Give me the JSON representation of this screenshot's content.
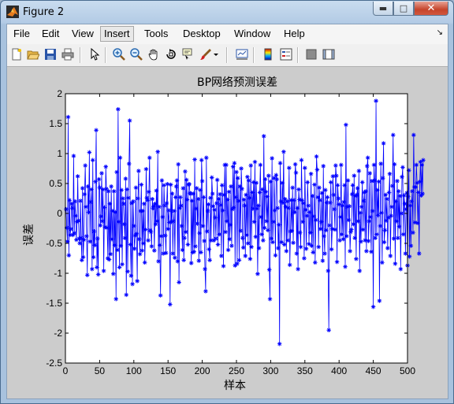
{
  "window": {
    "title": "Figure 2"
  },
  "menu": {
    "items": [
      "File",
      "Edit",
      "View",
      "Insert",
      "Tools",
      "Desktop",
      "Window",
      "Help"
    ]
  },
  "toolbar": {
    "icons": [
      "new-figure-icon",
      "open-file-icon",
      "save-icon",
      "print-icon",
      "select-arrow-icon",
      "zoom-in-icon",
      "zoom-out-icon",
      "pan-hand-icon",
      "rotate-3d-icon",
      "data-cursor-icon",
      "brush-icon",
      "link-plot-icon",
      "colorbar-icon",
      "legend-icon",
      "hide-plot-tools-icon",
      "show-plot-tools-icon"
    ]
  },
  "chart_data": {
    "type": "line",
    "title": "BP网络预测误差",
    "xlabel": "样本",
    "ylabel": "误差",
    "xlim": [
      0,
      500
    ],
    "ylim": [
      -2.5,
      2
    ],
    "xticks": [
      0,
      50,
      100,
      150,
      200,
      250,
      300,
      350,
      400,
      450,
      500
    ],
    "yticks": [
      -2.5,
      -2,
      -1.5,
      -1,
      -0.5,
      0,
      0.5,
      1,
      1.5,
      2
    ],
    "ytick_labels": [
      "-2.5",
      "-2",
      "-1.5",
      "-1",
      "-0.5",
      "0",
      "0.5",
      "1",
      "1.5",
      "2"
    ],
    "grid": false,
    "series": [
      {
        "color": "#0000ff",
        "marker": "*",
        "n_points": 500,
        "values": [
          0.07,
          -0.24,
          -0.47,
          1.61,
          -0.7,
          0.22,
          -0.36,
          -0.26,
          0.16,
          0.09,
          -0.36,
          0.96,
          -0.33,
          0.2,
          -0.04,
          -0.44,
          -0.14,
          0.62,
          -0.12,
          -0.42,
          -0.5,
          0.21,
          -0.41,
          -0.78,
          0.42,
          -0.73,
          -0.44,
          0.32,
          0.8,
          0.11,
          -0.38,
          -1.03,
          0.45,
          0.02,
          1.02,
          -0.47,
          0.19,
          0.4,
          -0.93,
          0.89,
          -0.73,
          -0.3,
          -0.53,
          0.53,
          1.39,
          -0.9,
          -0.42,
          -1.02,
          0.57,
          0.43,
          -0.2,
          -0.05,
          0.67,
          -0.13,
          0.4,
          -0.96,
          0.1,
          -0.23,
          0.78,
          0.41,
          -0.24,
          -0.75,
          0.37,
          -0.77,
          0.16,
          -0.68,
          0.45,
          -0.43,
          0.04,
          -1.01,
          0.37,
          -0.53,
          0.02,
          -1.43,
          0.69,
          -0.61,
          1.74,
          -0.14,
          -0.9,
          0.93,
          -0.54,
          0.39,
          -0.85,
          0.25,
          0.16,
          -0.18,
          -0.41,
          0.58,
          -1.36,
          0.4,
          -0.97,
          0.26,
          0.83,
          1.55,
          -0.52,
          -1.04,
          0.17,
          -1.18,
          0.2,
          -0.21,
          -0.59,
          -0.37,
          0.43,
          -0.34,
          -1.13,
          0.25,
          0.71,
          -0.43,
          -0.68,
          0.04,
          0.48,
          -0.62,
          0.04,
          -0.5,
          0.16,
          -0.82,
          -0.27,
          0.74,
          0.26,
          0.22,
          -0.45,
          0.36,
          0.93,
          -0.28,
          -0.31,
          -0.55,
          0.24,
          0.09,
          0.12,
          -0.62,
          0.16,
          -0.18,
          0.38,
          -0.13,
          1.03,
          -0.8,
          0.11,
          -0.53,
          -1.37,
          -0.38,
          0.55,
          -0.06,
          -0.67,
          0.47,
          0.13,
          -0.37,
          -0.66,
          0.17,
          0.49,
          -0.26,
          0.05,
          -0.15,
          -1.52,
          0.48,
          -0.14,
          0.33,
          -0.67,
          -0.13,
          0.04,
          -0.74,
          0.27,
          0.45,
          0.55,
          -0.8,
          0.82,
          -1.15,
          0.09,
          0.27,
          0.13,
          -0.21,
          -0.61,
          0.42,
          -0.78,
          -0.41,
          0.7,
          -0.31,
          0.56,
          0.23,
          -0.52,
          0.48,
          0.49,
          0.34,
          0.33,
          -0.83,
          0.21,
          -0.65,
          0.33,
          -0.64,
          0.9,
          -0.55,
          0.08,
          0.42,
          -0.17,
          0.24,
          -0.79,
          -0.33,
          0.39,
          -0.65,
          0.89,
          0.54,
          -0.21,
          0.27,
          -0.46,
          -0.93,
          -1.3,
          0.93,
          -0.3,
          0.04,
          0.15,
          -0.6,
          -0.78,
          0.26,
          -0.45,
          0.6,
          0.33,
          0.12,
          -0.45,
          0.06,
          -0.07,
          -0.42,
          0.17,
          0.56,
          -0.52,
          0.24,
          -0.35,
          0.32,
          0.14,
          -0.71,
          0.47,
          0.05,
          -0.88,
          0.31,
          0.81,
          -0.31,
          0.81,
          -0.13,
          0.23,
          -0.61,
          0.36,
          -0.43,
          -0.19,
          0.45,
          -0.54,
          0.07,
          0.78,
          0.1,
          0.84,
          -0.87,
          0.27,
          0.69,
          -0.84,
          0.59,
          0.21,
          -0.78,
          0.45,
          -0.29,
          0.75,
          0.41,
          -0.41,
          -0.57,
          0.23,
          0.13,
          -0.71,
          0.31,
          -0.36,
          0.61,
          -0.5,
          0.55,
          0.26,
          -0.76,
          0.8,
          -0.56,
          0.35,
          0.08,
          0.52,
          -0.14,
          0.86,
          -0.39,
          0.51,
          0.08,
          -1.01,
          0.13,
          -0.58,
          0.35,
          0.81,
          -0.06,
          -0.35,
          0.4,
          -0.45,
          1.29,
          -0.24,
          0.57,
          0.36,
          -0.13,
          0.28,
          -0.28,
          0.63,
          -0.94,
          -1.43,
          0.53,
          -0.42,
          0.92,
          -0.48,
          -0.14,
          0.59,
          0.05,
          -0.7,
          0.64,
          0.57,
          0.09,
          -0.58,
          -0.19,
          -2.18,
          0.84,
          0.2,
          -0.48,
          0.51,
          0.18,
          1.03,
          -0.52,
          0.24,
          0.11,
          -0.63,
          0.2,
          -0.45,
          0.09,
          0.76,
          -0.86,
          -0.3,
          0.22,
          -0.29,
          0.43,
          -0.49,
          0.22,
          0.02,
          0.82,
          0.68,
          -0.67,
          0.09,
          -0.93,
          0.4,
          0.23,
          -0.32,
          -0.56,
          0.89,
          0.22,
          -0.14,
          0.17,
          -0.75,
          0.76,
          0.06,
          -0.59,
          -0.04,
          0.52,
          0.13,
          -0.51,
          0.02,
          -0.32,
          0.66,
          -0.54,
          0.29,
          -0.65,
          -0.05,
          0.48,
          -0.82,
          -0.11,
          0.95,
          0.73,
          0.27,
          -0.56,
          0.43,
          0.22,
          -0.26,
          -0.14,
          0.34,
          -0.79,
          0.79,
          -0.38,
          -0.67,
          0.39,
          -0.28,
          0.18,
          0.27,
          -0.96,
          -1.95,
          -0.2,
          0.18,
          0.52,
          -0.6,
          -0.26,
          0.62,
          0.31,
          0.07,
          -0.27,
          0.8,
          0.63,
          -0.81,
          0.47,
          0.25,
          0.15,
          -0.45,
          -0.06,
          0.81,
          -0.35,
          0.13,
          -0.43,
          0.19,
          0.47,
          -0.89,
          1.48,
          -0.38,
          0.11,
          0.55,
          -0.11,
          0.12,
          -0.63,
          -0.31,
          -0.27,
          0.32,
          0.47,
          -0.18,
          0.63,
          -0.41,
          0.29,
          -0.76,
          0.31,
          0.42,
          -0.13,
          0.71,
          -0.96,
          0.01,
          -0.47,
          0.11,
          0.52,
          -0.27,
          0.21,
          0.35,
          -0.45,
          0.37,
          -0.63,
          0.79,
          0.93,
          -0.46,
          -0.13,
          0.67,
          -0.06,
          -0.64,
          0.54,
          0.04,
          -1.56,
          0.81,
          0.55,
          -0.41,
          1.88,
          -0.35,
          0.39,
          -0.03,
          0.53,
          -1.46,
          -0.21,
          0.83,
          0.01,
          -0.82,
          0.59,
          1.17,
          -0.48,
          -0.28,
          0.31,
          -0.12,
          0.24,
          -0.58,
          -0.07,
          0.35,
          0.66,
          -0.71,
          -0.04,
          0.11,
          0.46,
          1.31,
          -0.42,
          0.82,
          -0.84,
          0.2,
          -0.13,
          0.54,
          -0.41,
          0.37,
          -0.22,
          0.29,
          -0.93,
          0.0,
          0.61,
          0.77,
          -0.35,
          0.3,
          0.16,
          -0.67,
          0.07,
          0.34,
          -0.87,
          0.28,
          0.72,
          -0.72,
          0.13,
          -0.54,
          0.2,
          0.37,
          -0.32,
          1.31,
          0.44,
          -0.15,
          0.44,
          0.81,
          0.51,
          -0.16,
          0.35,
          -0.67,
          0.53,
          0.86,
          0.3,
          0.81,
          0.33,
          0.89
        ]
      }
    ]
  }
}
